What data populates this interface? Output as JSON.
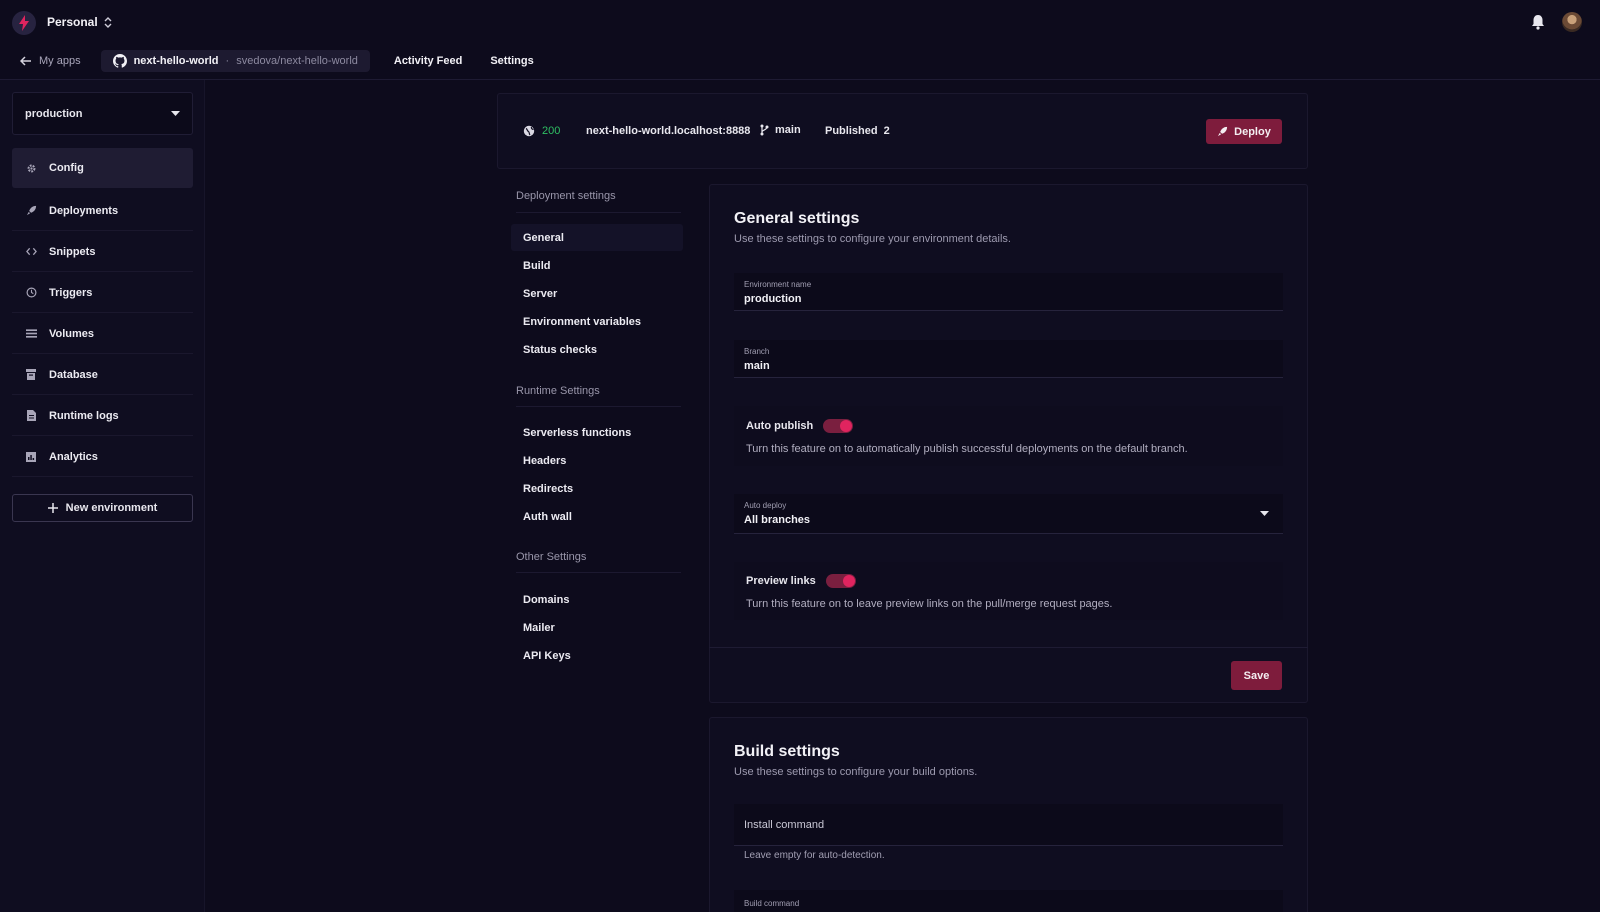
{
  "header": {
    "workspace": "Personal",
    "back_label": "My apps",
    "app_name": "next-hello-world",
    "separator": "·",
    "repo_path": "svedova/next-hello-world",
    "nav": [
      "Activity Feed",
      "Settings"
    ]
  },
  "sidebar": {
    "environment": "production",
    "items": [
      {
        "label": "Config",
        "icon": "gear-icon"
      },
      {
        "label": "Deployments",
        "icon": "rocket-icon"
      },
      {
        "label": "Snippets",
        "icon": "code-icon"
      },
      {
        "label": "Triggers",
        "icon": "clock-icon"
      },
      {
        "label": "Volumes",
        "icon": "list-icon"
      },
      {
        "label": "Database",
        "icon": "database-icon"
      },
      {
        "label": "Runtime logs",
        "icon": "document-icon"
      },
      {
        "label": "Analytics",
        "icon": "chart-icon"
      }
    ],
    "new_env_label": "New environment"
  },
  "status": {
    "code": "200",
    "host": "next-hello-world.localhost:8888",
    "branch": "main",
    "published_label": "Published",
    "published_count": "2",
    "deploy_label": "Deploy"
  },
  "menu": {
    "groups": [
      {
        "title": "Deployment settings",
        "items": [
          "General",
          "Build",
          "Server",
          "Environment variables",
          "Status checks"
        ]
      },
      {
        "title": "Runtime Settings",
        "items": [
          "Serverless functions",
          "Headers",
          "Redirects",
          "Auth wall"
        ]
      },
      {
        "title": "Other Settings",
        "items": [
          "Domains",
          "Mailer",
          "API Keys"
        ]
      }
    ]
  },
  "general": {
    "title": "General settings",
    "subtitle": "Use these settings to configure your environment details.",
    "env_name_label": "Environment name",
    "env_name_value": "production",
    "branch_label": "Branch",
    "branch_value": "main",
    "auto_publish_label": "Auto publish",
    "auto_publish_on": true,
    "auto_publish_desc": "Turn this feature on to automatically publish successful deployments on the default branch.",
    "auto_deploy_label": "Auto deploy",
    "auto_deploy_value": "All branches",
    "preview_links_label": "Preview links",
    "preview_links_on": true,
    "preview_links_desc": "Turn this feature on to leave preview links on the pull/merge request pages.",
    "save_label": "Save"
  },
  "build": {
    "title": "Build settings",
    "subtitle": "Use these settings to configure your build options.",
    "install_placeholder": "Install command",
    "install_hint": "Leave empty for auto-detection.",
    "build_command_label": "Build command"
  },
  "colors": {
    "accent": "#7e1c3c",
    "toggle_knob": "#e0245f",
    "status_ok": "#2fbf63",
    "background": "#0d0b1c"
  }
}
